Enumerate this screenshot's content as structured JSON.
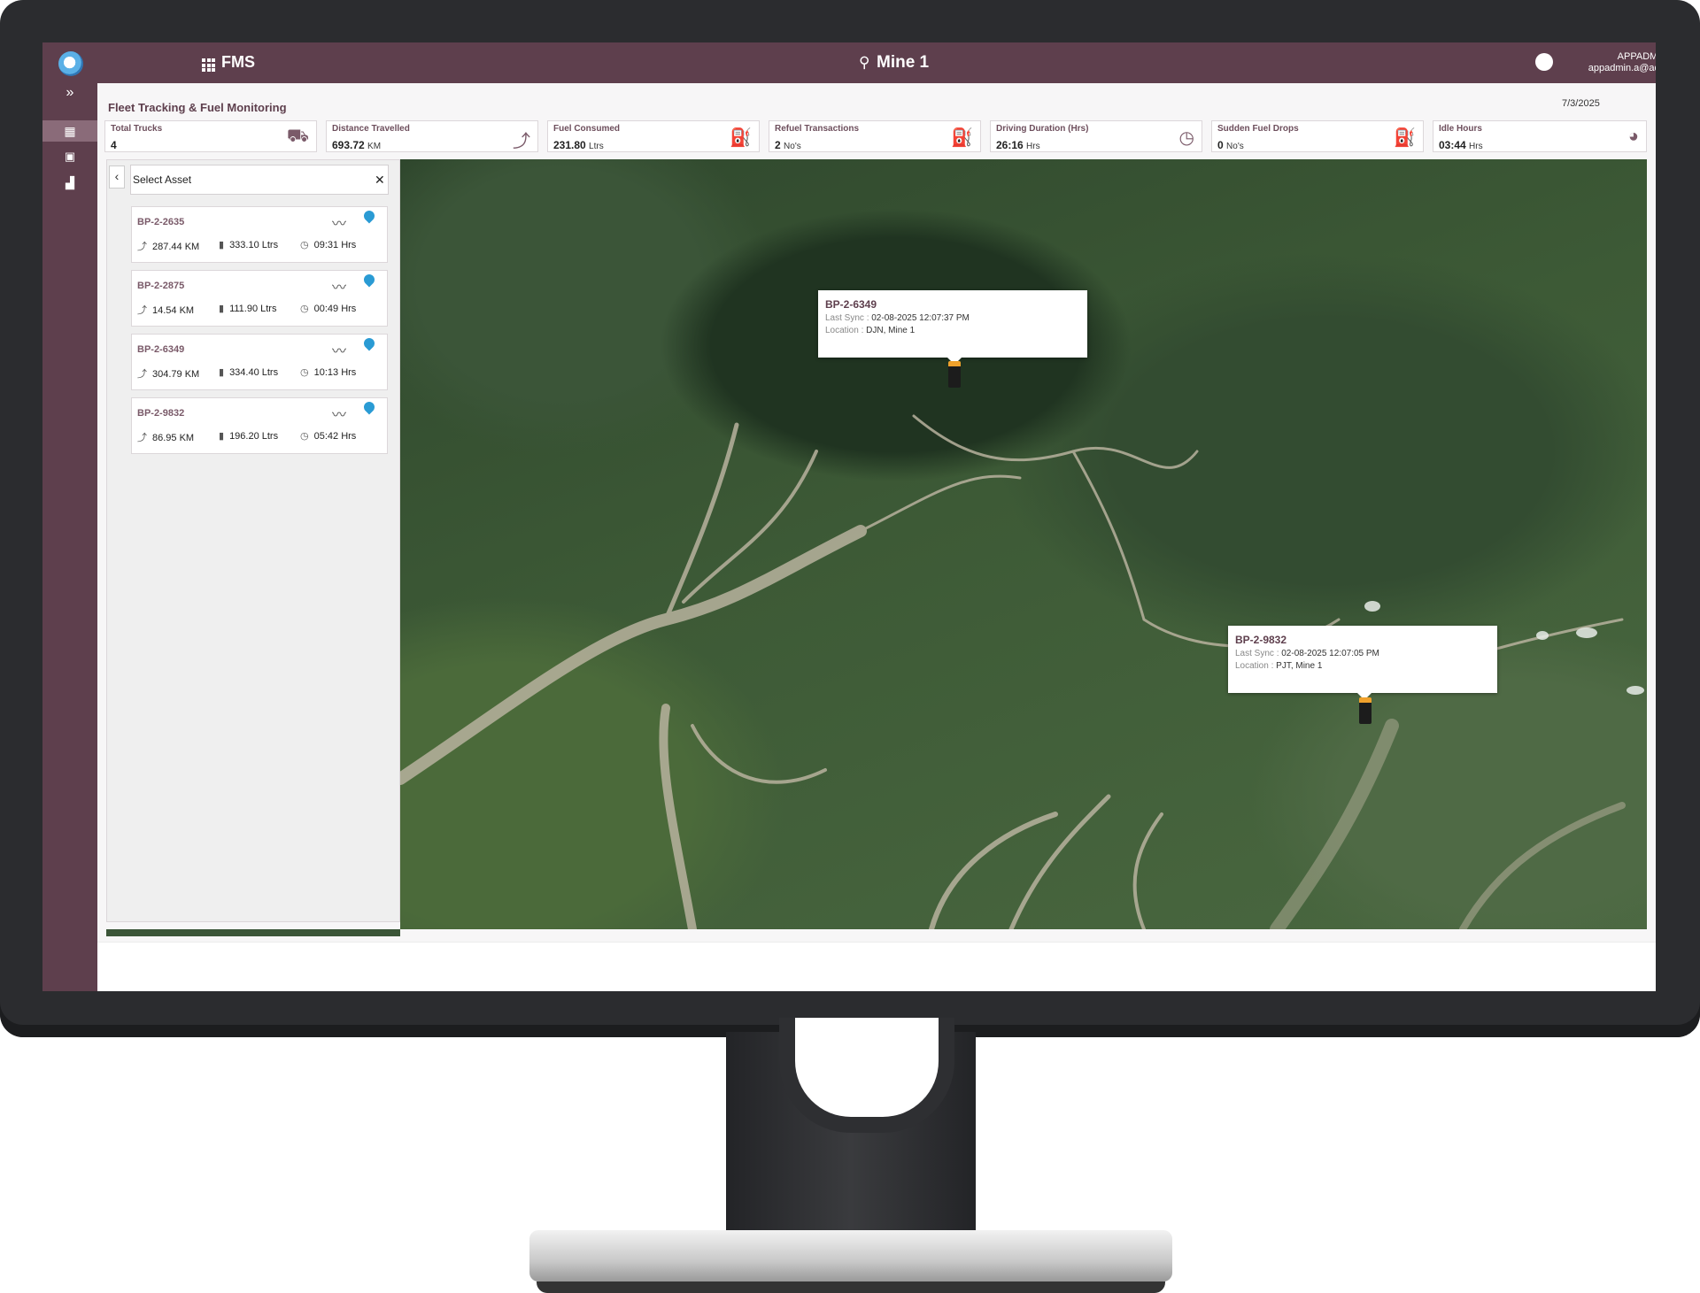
{
  "app": {
    "name": "FMS",
    "site": "Mine 1"
  },
  "user": {
    "name": "APPADMIN",
    "email": "appadmin.a@admin.com"
  },
  "page": {
    "title": "Fleet Tracking & Fuel Monitoring",
    "date": "7/3/2025"
  },
  "kpis": [
    {
      "label": "Total Trucks",
      "value": "4",
      "unit": "",
      "icon": "truck-icon"
    },
    {
      "label": "Distance Travelled",
      "value": "693.72",
      "unit": "KM",
      "icon": "route-icon"
    },
    {
      "label": "Fuel Consumed",
      "value": "231.80",
      "unit": "Ltrs",
      "icon": "fuel-pump-icon"
    },
    {
      "label": "Refuel Transactions",
      "value": "2",
      "unit": "No's",
      "icon": "refuel-icon"
    },
    {
      "label": "Driving Duration (Hrs)",
      "value": "26:16",
      "unit": "Hrs",
      "icon": "clock-icon"
    },
    {
      "label": "Sudden Fuel Drops",
      "value": "0",
      "unit": "No's",
      "icon": "fuel-drop-icon"
    },
    {
      "label": "Idle Hours",
      "value": "03:44",
      "unit": "Hrs",
      "icon": "pie-icon"
    }
  ],
  "asset_panel": {
    "placeholder": "Select Asset"
  },
  "assets": [
    {
      "id": "BP-2-2635",
      "distance": "287.44 KM",
      "fuel": "333.10 Ltrs",
      "duration": "09:31 Hrs"
    },
    {
      "id": "BP-2-2875",
      "distance": "14.54 KM",
      "fuel": "111.90 Ltrs",
      "duration": "00:49 Hrs"
    },
    {
      "id": "BP-2-6349",
      "distance": "304.79 KM",
      "fuel": "334.40 Ltrs",
      "duration": "10:13 Hrs"
    },
    {
      "id": "BP-2-9832",
      "distance": "86.95 KM",
      "fuel": "196.20 Ltrs",
      "duration": "05:42 Hrs"
    }
  ],
  "map_popups": [
    {
      "id": "BP-2-6349",
      "sync_label": "Last Sync :",
      "sync": "02-08-2025 12:07:37 PM",
      "loc_label": "Location :",
      "location": "DJN, Mine 1"
    },
    {
      "id": "BP-2-9832",
      "sync_label": "Last Sync :",
      "sync": "02-08-2025 12:07:05 PM",
      "loc_label": "Location :",
      "location": "PJT, Mine 1"
    }
  ],
  "colors": {
    "brand": "#5e3f4d",
    "accent_pin": "#2a9bd4",
    "truck_marker": "#f0a12c"
  }
}
